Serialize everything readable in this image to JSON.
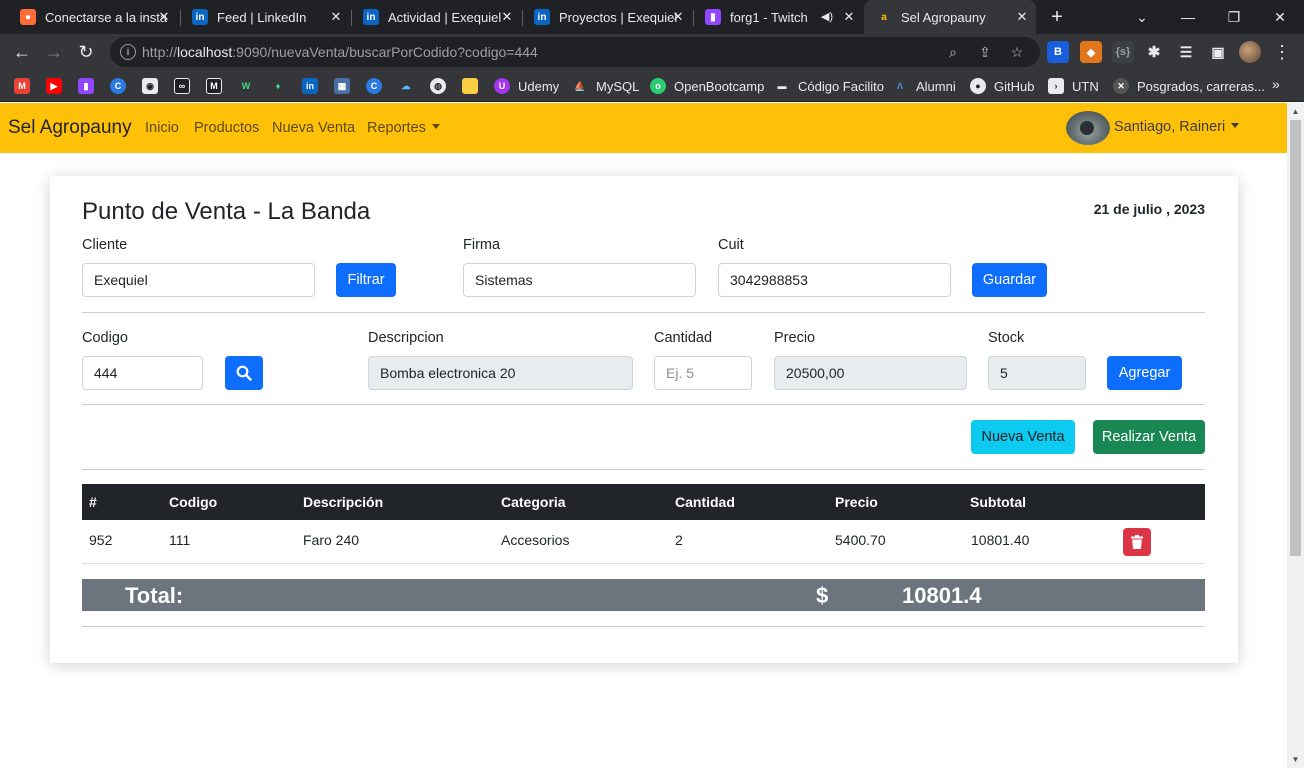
{
  "browser": {
    "tabs": [
      {
        "title": "Conectarse a la insta",
        "icon": "postman-icon",
        "color": "#ff6c37"
      },
      {
        "title": "Feed | LinkedIn",
        "icon": "linkedin-icon",
        "color": "#0a66c2"
      },
      {
        "title": "Actividad | Exequiel",
        "icon": "linkedin-icon",
        "color": "#0a66c2"
      },
      {
        "title": "Proyectos | Exequiel",
        "icon": "linkedin-icon",
        "color": "#0a66c2"
      },
      {
        "title": "forg1 - Twitch",
        "icon": "twitch-icon",
        "color": "#9146ff"
      },
      {
        "title": "Sel Agropauny",
        "icon": "app-icon",
        "color": "#ffc107"
      }
    ],
    "url_prefix": "http://",
    "url_host": "localhost",
    "url_rest": ":9090/nuevaVenta/buscarPorCodido?codigo=444",
    "bookmarks": [
      {
        "label": "Udemy",
        "icon": "udemy-icon",
        "color": "#a435f0"
      },
      {
        "label": "MySQL",
        "icon": "mysql-icon",
        "color": "#00758f"
      },
      {
        "label": "OpenBootcamp",
        "icon": "openbootcamp-icon",
        "color": "#2ecc71"
      },
      {
        "label": "Código Facilito",
        "icon": "codigofacilito-icon",
        "color": "#3c3c3c"
      },
      {
        "label": "Alumni",
        "icon": "alumni-icon",
        "color": "#4a90d9"
      },
      {
        "label": "GitHub",
        "icon": "github-icon",
        "color": "#e8eaed"
      },
      {
        "label": "UTN",
        "icon": "utn-icon",
        "color": "#202124"
      },
      {
        "label": "Posgrados, carreras...",
        "icon": "posgrados-icon",
        "color": "#555555"
      }
    ]
  },
  "nav": {
    "brand": "Sel Agropauny",
    "links": [
      "Inicio",
      "Productos",
      "Nueva Venta"
    ],
    "reports": "Reportes",
    "user": "Santiago, Raineri"
  },
  "sale": {
    "title": "Punto de Venta - La Banda",
    "date": "21 de julio , 2023",
    "cliente_label": "Cliente",
    "cliente_value": "Exequiel",
    "filtrar": "Filtrar",
    "firma_label": "Firma",
    "firma_value": "Sistemas",
    "cuit_label": "Cuit",
    "cuit_value": "3042988853",
    "guardar": "Guardar",
    "codigo_label": "Codigo",
    "codigo_value": "444",
    "descripcion_label": "Descripcion",
    "descripcion_value": "Bomba electronica 20",
    "cantidad_label": "Cantidad",
    "cantidad_placeholder": "Ej. 5",
    "precio_label": "Precio",
    "precio_value": "20500,00",
    "stock_label": "Stock",
    "stock_value": "5",
    "agregar": "Agregar",
    "nueva_venta": "Nueva Venta",
    "realizar_venta": "Realizar Venta"
  },
  "table": {
    "headers": [
      "#",
      "Codigo",
      "Descripción",
      "Categoria",
      "Cantidad",
      "Precio",
      "Subtotal"
    ],
    "rows": [
      {
        "id": "952",
        "codigo": "111",
        "descripcion": "Faro 240",
        "categoria": "Accesorios",
        "cantidad": "2",
        "precio": "5400.70",
        "subtotal": "10801.40"
      }
    ]
  },
  "total": {
    "label": "Total:",
    "currency": "$",
    "value": "10801.4"
  }
}
